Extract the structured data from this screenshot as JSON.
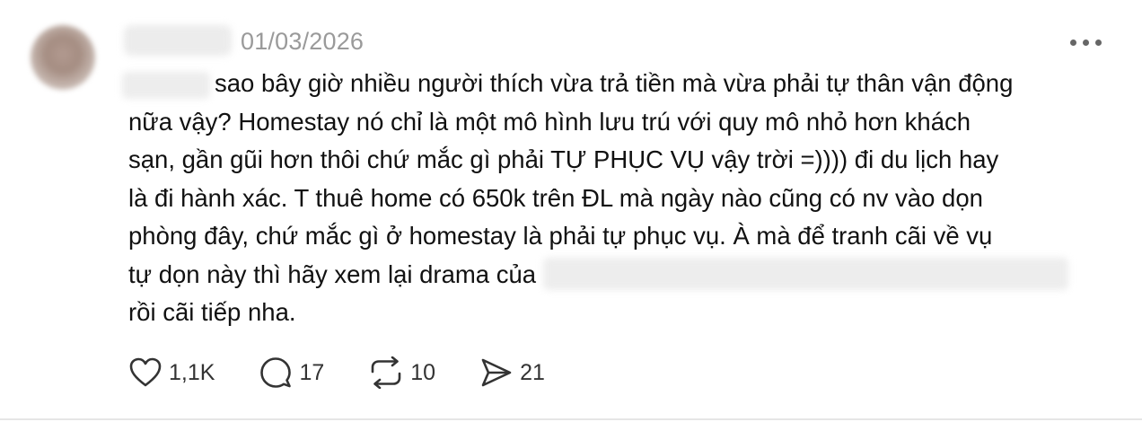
{
  "post": {
    "date": "01/03/2026",
    "body_lines": [
      "sao bây giờ nhiều người thích vừa trả tiền mà vừa phải tự thân vận động",
      "nữa vậy? Homestay nó chỉ là một mô hình lưu trú với quy mô nhỏ hơn khách",
      "sạn, gần gũi hơn thôi chứ mắc gì phải TỰ PHỤC VỤ vậy trời =)))) đi du lịch hay",
      "là đi hành xác. T thuê home có 650k trên ĐL mà ngày nào cũng có nv vào dọn",
      "phòng đây, chứ mắc gì ở homestay là phải tự phục vụ. À mà để tranh cãi về vụ",
      "tự dọn này thì hãy xem lại drama của",
      "rồi cãi tiếp nha."
    ]
  },
  "actions": {
    "likes": "1,1K",
    "replies": "17",
    "reposts": "10",
    "shares": "21"
  },
  "icons": {
    "like": "heart-icon",
    "reply": "speech-bubble-icon",
    "repost": "repost-arrows-icon",
    "share": "paper-plane-icon",
    "more": "more-horizontal-icon"
  }
}
